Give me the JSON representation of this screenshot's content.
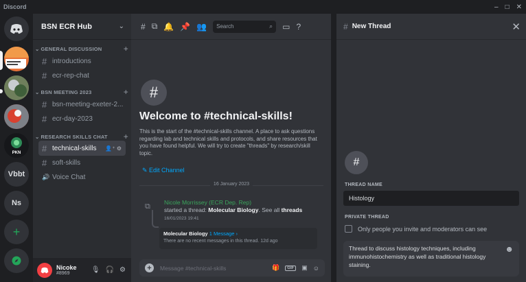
{
  "window": {
    "app_name": "Discord",
    "controls": [
      "–",
      "□",
      "✕"
    ]
  },
  "servers": [
    {
      "label": "",
      "icon": "discord-logo-icon"
    },
    {
      "label": "",
      "icon": "server-icon-orange"
    },
    {
      "label": "",
      "icon": "server-icon-photo"
    },
    {
      "label": "",
      "icon": "server-icon-red"
    },
    {
      "label": "PKN",
      "icon": "server-icon-pkn"
    },
    {
      "label": "Vbbt",
      "icon": ""
    },
    {
      "label": "Ns",
      "icon": ""
    },
    {
      "label": "+",
      "icon": "add-server-icon"
    },
    {
      "label": "",
      "icon": "explore-icon"
    }
  ],
  "guild": {
    "name": "BSN ECR Hub",
    "categories": [
      {
        "name": "GENERAL DISCUSSION",
        "channels": [
          "introductions",
          "ecr-rep-chat"
        ]
      },
      {
        "name": "BSN MEETING 2023",
        "channels": [
          "bsn-meeting-exeter-2...",
          "ecr-day-2023"
        ]
      },
      {
        "name": "RESEARCH SKILLS CHAT",
        "channels": [
          "technical-skills",
          "soft-skills",
          "Voice Chat"
        ]
      }
    ],
    "active_channel": "technical-skills"
  },
  "user": {
    "name": "Nicoke",
    "tag": "#8969"
  },
  "toolbar": {
    "search_placeholder": "Search"
  },
  "channel_intro": {
    "welcome": "Welcome to #technical-skills!",
    "description": "This is the start of the #technical-skills channel. A place to ask questions regarding lab and technical skills and protocols, and share resources that you have found helpful. We will try to create \"threads\" by research/skill topic.",
    "edit_link": "Edit Channel"
  },
  "divider_date": "16 January 2023",
  "message": {
    "author": "Nicole Morrissey (ECR Dep. Rep)",
    "text_1": "started a thread: ",
    "thread_name": "Molecular Biology",
    "text_2": ". See all ",
    "threads_word": "threads",
    "timestamp": "16/01/2023 19:41"
  },
  "thread_card": {
    "name": "Molecular Biology",
    "count": "1 Message ›",
    "preview": "There are no recent messages in this thread.",
    "age": "12d ago"
  },
  "composer": {
    "placeholder": "Message #technical-skills",
    "gif_label": "GIF"
  },
  "thread_panel": {
    "title": "New Thread",
    "name_label": "THREAD NAME",
    "name_value": "Histology",
    "private_label": "PRIVATE THREAD",
    "private_text": "Only people you invite and moderators can see",
    "starter_message": "Thread to discuss histology techniques, including immunohistochemistry as well as traditional histology staining."
  },
  "colors": {
    "accent_link": "#00a8fc",
    "author_green": "#3ba55c",
    "mention_red": "#f23f43"
  }
}
